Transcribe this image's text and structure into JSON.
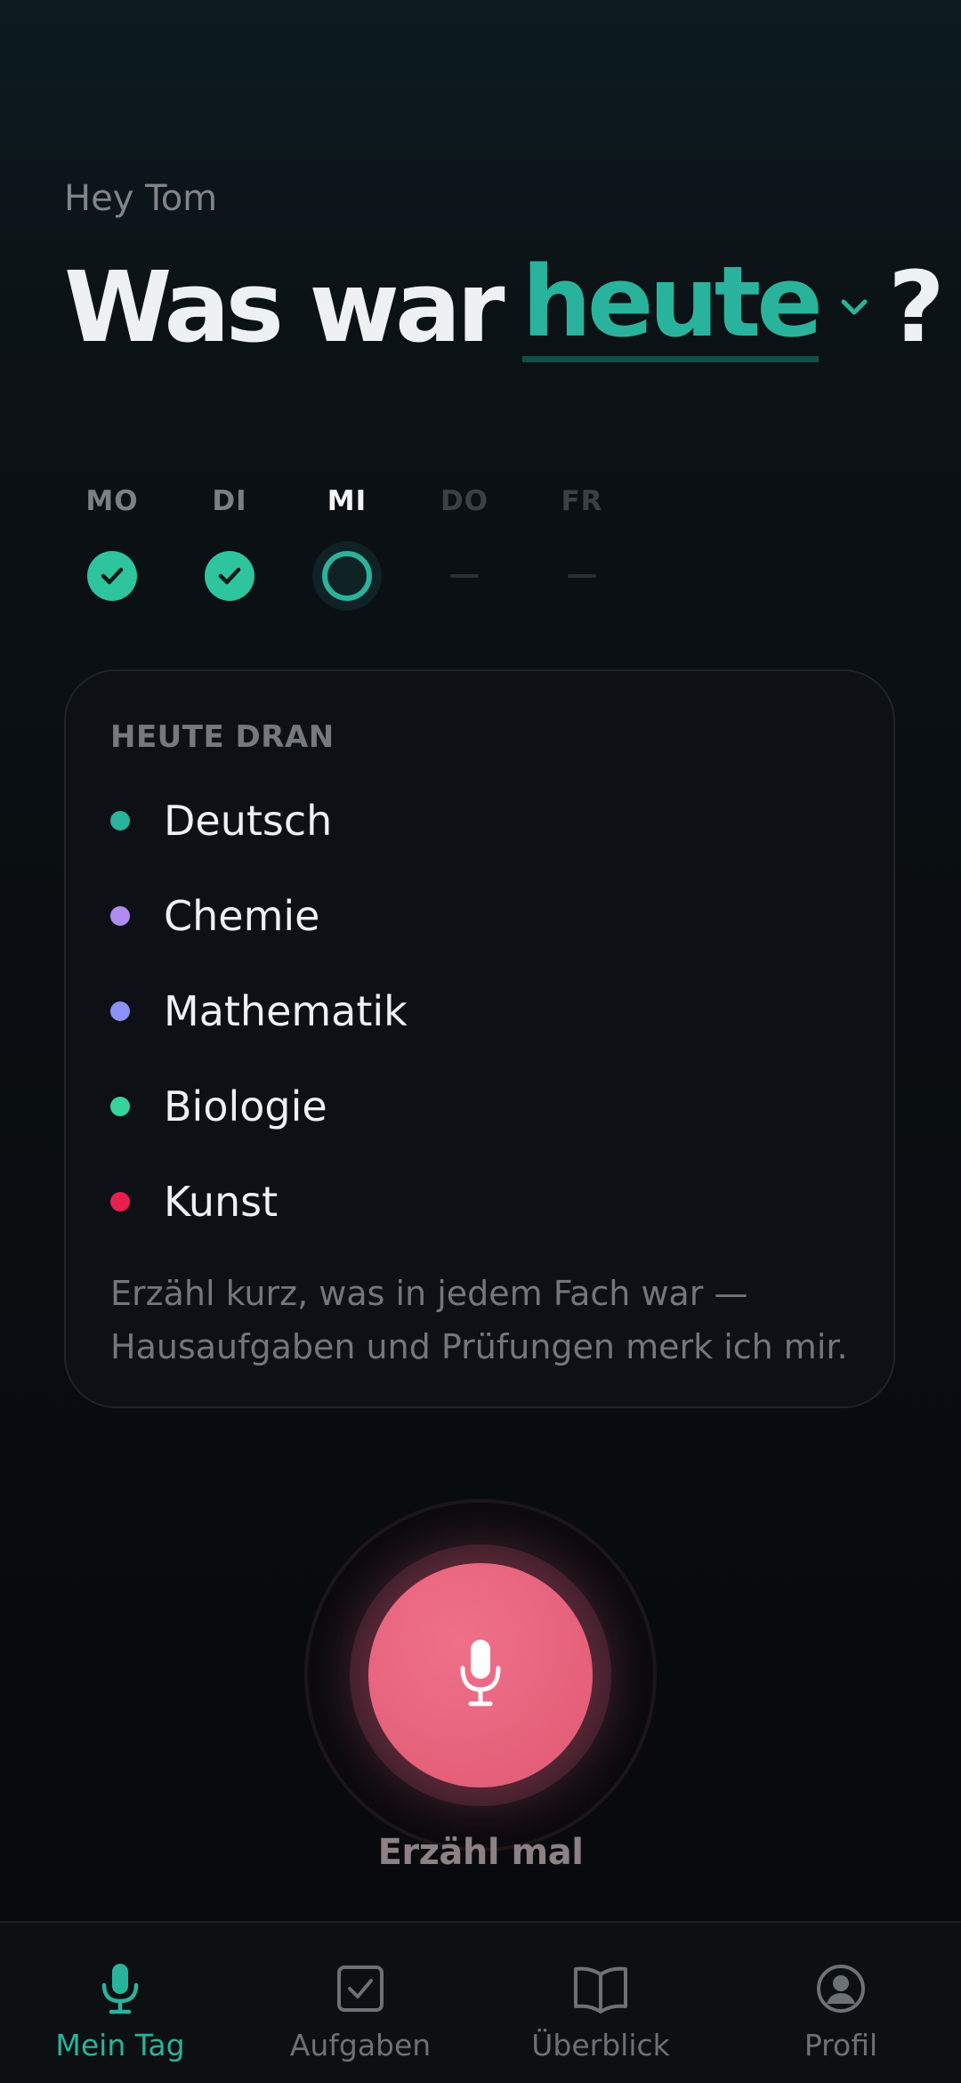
{
  "greeting": "Hey Tom",
  "headline": {
    "prefix": "Was war",
    "accent": "heute",
    "suffix": "?"
  },
  "week": [
    {
      "label": "MO",
      "status": "done"
    },
    {
      "label": "DI",
      "status": "done"
    },
    {
      "label": "MI",
      "status": "today"
    },
    {
      "label": "DO",
      "status": "future"
    },
    {
      "label": "FR",
      "status": "future"
    }
  ],
  "today_card": {
    "title": "HEUTE DRAN",
    "subjects": [
      {
        "name": "Deutsch",
        "color": "#2ab39c"
      },
      {
        "name": "Chemie",
        "color": "#b18cf2"
      },
      {
        "name": "Mathematik",
        "color": "#8a93f5"
      },
      {
        "name": "Biologie",
        "color": "#36d39b"
      },
      {
        "name": "Kunst",
        "color": "#e8204f"
      }
    ],
    "note": "Erzähl kurz, was in jedem Fach war — Hausaufgaben und Prüfungen merk ich mir."
  },
  "record": {
    "label": "Erzähl mal"
  },
  "tabs": [
    {
      "label": "Mein Tag",
      "icon": "mic-icon",
      "active": true
    },
    {
      "label": "Aufgaben",
      "icon": "checkbox-icon",
      "active": false
    },
    {
      "label": "Überblick",
      "icon": "book-icon",
      "active": false
    },
    {
      "label": "Profil",
      "icon": "profile-icon",
      "active": false
    }
  ],
  "colors": {
    "accent": "#2ab39c",
    "done": "#2ec49d",
    "record": "#e8647e"
  }
}
